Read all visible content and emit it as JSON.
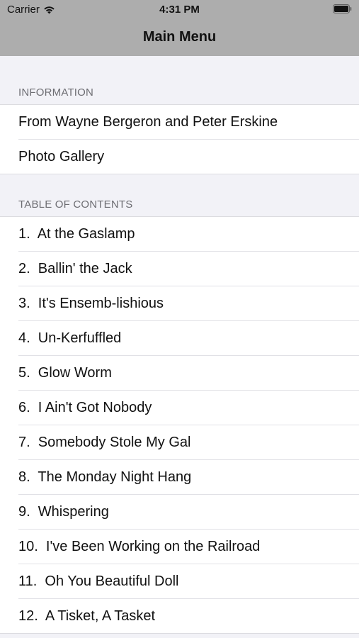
{
  "status_bar": {
    "carrier": "Carrier",
    "time": "4:31 PM",
    "icons": [
      "wifi-icon",
      "battery-icon"
    ]
  },
  "nav": {
    "title": "Main Menu"
  },
  "sections": [
    {
      "header": "INFORMATION",
      "items": [
        {
          "label": "From Wayne Bergeron and Peter Erskine"
        },
        {
          "label": "Photo Gallery"
        }
      ]
    },
    {
      "header": "TABLE OF CONTENTS",
      "items": [
        {
          "label": "1.  At the Gaslamp"
        },
        {
          "label": "2.  Ballin' the Jack"
        },
        {
          "label": "3.  It's Ensemb-lishious"
        },
        {
          "label": "4.  Un-Kerfuffled"
        },
        {
          "label": "5.  Glow Worm"
        },
        {
          "label": "6.  I Ain't Got Nobody"
        },
        {
          "label": "7.  Somebody Stole My Gal"
        },
        {
          "label": "8.  The Monday Night Hang"
        },
        {
          "label": "9.  Whispering"
        },
        {
          "label": "10.  I've Been Working on the Railroad"
        },
        {
          "label": "11.  Oh You Beautiful Doll"
        },
        {
          "label": "12.  A Tisket, A Tasket"
        }
      ]
    }
  ],
  "colors": {
    "nav_bar": "#adadad",
    "background": "#f2f2f7",
    "section_header_text": "#6d6d72",
    "row_background": "#ffffff"
  }
}
